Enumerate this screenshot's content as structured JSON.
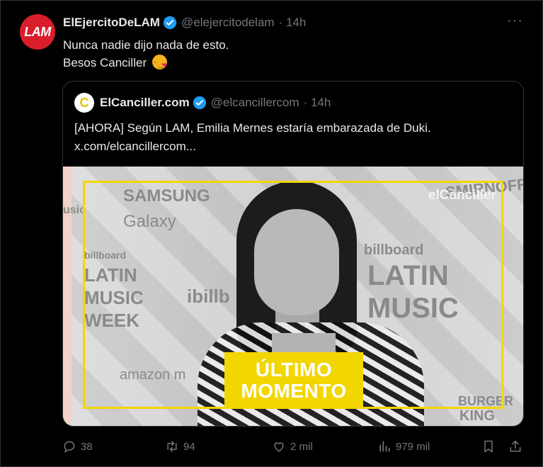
{
  "tweet": {
    "author_name": "ElEjercitoDeLAM",
    "author_handle": "@elejercitodelam",
    "time": "· 14h",
    "avatar_text": "LAM",
    "lines": [
      "Nunca nadie dijo nada de esto.",
      "Besos Canciller"
    ],
    "more": "···"
  },
  "quote": {
    "author_name": "ElCanciller.com",
    "author_handle": "@elcancillercom",
    "time": "· 14h",
    "avatar_text": "C",
    "lines": [
      "[AHORA] Según LAM, Emilia Mernes estaría embarazada de Duki.",
      "x.com/elcancillercom..."
    ]
  },
  "media": {
    "watermark": "elCanciller",
    "badge_line1": "ÚLTIMO",
    "badge_line2": "MOMENTO",
    "wall_texts": {
      "samsung": "SAMSUNG",
      "galaxy": "Galaxy",
      "billboard1": "billboard",
      "latin1": "LATIN",
      "music1": "MUSIC",
      "week": "WEEK",
      "billboard2": "billboard",
      "latin2": "LATIN",
      "music2": "MUSIC",
      "ibillboard": "ibillb",
      "amazon": "amazon m",
      "burger": "BURGER",
      "king": "KING",
      "smirnoff": "SMIRNOFF",
      "usic": "usic"
    }
  },
  "actions": {
    "reply_count": "38",
    "retweet_count": "94",
    "like_count": "2 mil",
    "views_count": "979 mil"
  },
  "colors": {
    "background": "#000000",
    "verified": "#1d9bf0",
    "accent_yellow": "#f2d600",
    "lam_red": "#d91d2a"
  }
}
